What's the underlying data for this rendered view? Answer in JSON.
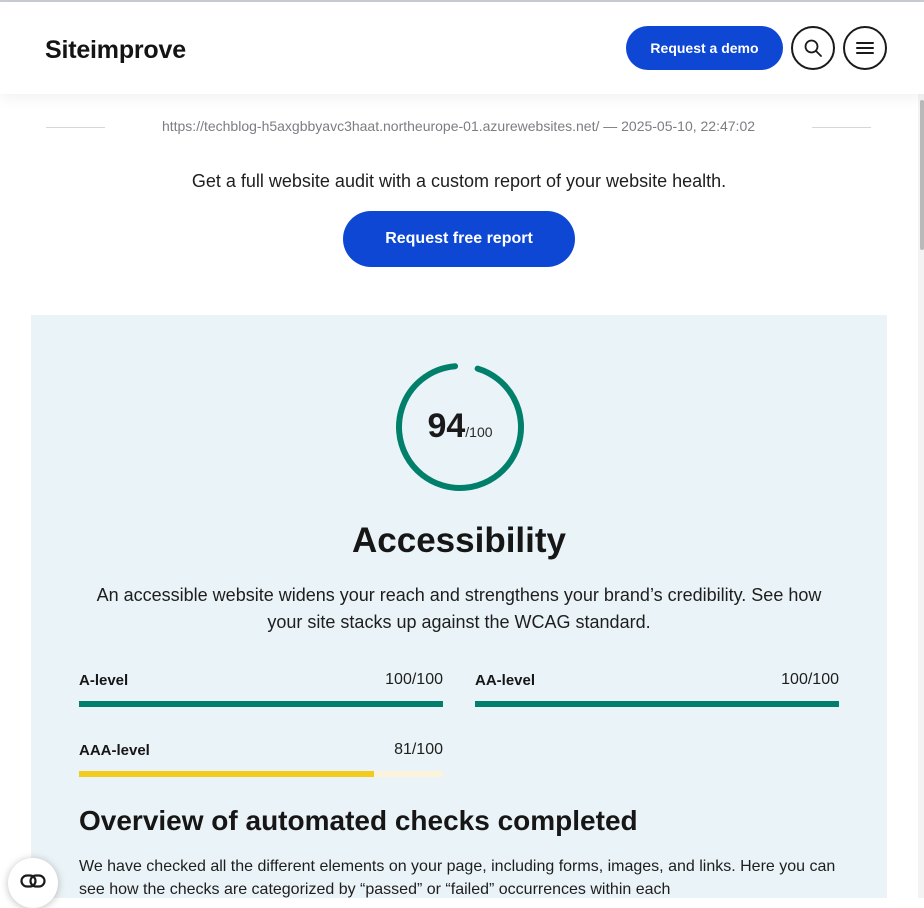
{
  "header": {
    "logo": "Siteimprove",
    "demo_label": "Request a demo",
    "search_icon": "search-icon",
    "menu_icon": "hamburger-menu-icon"
  },
  "meta": {
    "scan_info": "https://techblog-h5axgbbyavc3haat.northeurope-01.azurewebsites.net/ — 2025-05-10, 22:47:02"
  },
  "audit": {
    "text": "Get a full website audit with a custom report of your website health.",
    "button_label": "Request free report"
  },
  "accessibility": {
    "score": "94",
    "score_max": "/100",
    "score_value": 94,
    "title": "Accessibility",
    "description": "An accessible website widens your reach and strengthens your brand’s credibility. See how your site stacks up against the WCAG standard.",
    "levels": [
      {
        "name": "A-level",
        "score": "100/100",
        "value": 100,
        "color": "#00806b"
      },
      {
        "name": "AA-level",
        "score": "100/100",
        "value": 100,
        "color": "#00806b"
      },
      {
        "name": "AAA-level",
        "score": "81/100",
        "value": 81,
        "color": "#f2cb1d"
      }
    ]
  },
  "overview": {
    "title": "Overview of automated checks completed",
    "text": "We have checked all the different elements on your page, including forms, images, and links. Here you can see how the checks are categorized by “passed” or “failed” occurrences within each"
  },
  "colors": {
    "brand_blue": "#0d47d4",
    "gauge_green": "#00806b",
    "panel_bg": "#eaf3f7"
  },
  "chat_icon": "chat-link-icon"
}
